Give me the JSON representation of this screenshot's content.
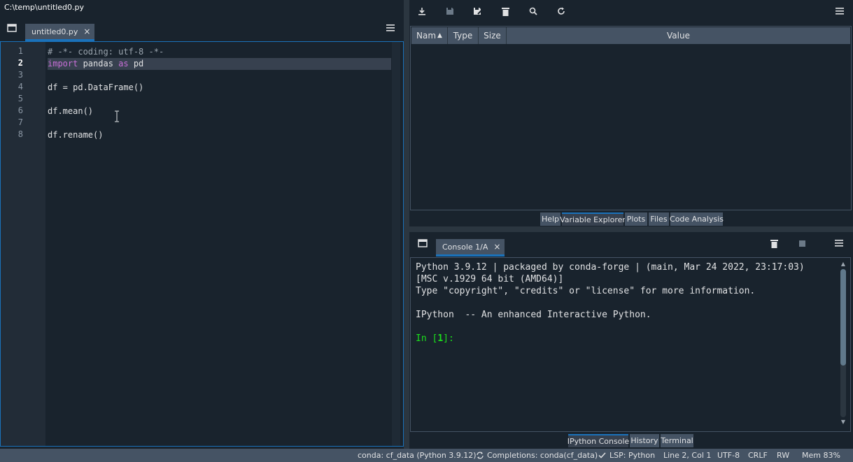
{
  "window": {
    "path": "C:\\temp\\untitled0.py"
  },
  "editor": {
    "tab_label": "untitled0.py",
    "tab_close": "×",
    "line_numbers": [
      "1",
      "2",
      "3",
      "4",
      "5",
      "6",
      "7",
      "8"
    ],
    "current_line": 2,
    "lines": {
      "l1": "# -*- coding: utf-8 -*-",
      "l2_kw1": "import",
      "l2_mid": " pandas ",
      "l2_kw2": "as",
      "l2_end": " pd",
      "l4": "df = pd.DataFrame()",
      "l6": "df.mean()",
      "l8": "df.rename()"
    },
    "icons": {
      "browse": "browse-tabs-icon",
      "options": "hamburger-menu-icon"
    }
  },
  "variable_explorer": {
    "columns": {
      "name": "Nam",
      "type": "Type",
      "size": "Size",
      "value": "Value"
    },
    "sort_indicator": "▲",
    "toolbar_icons": [
      "import-data-icon",
      "save-icon",
      "save-as-icon",
      "delete-all-icon",
      "search-icon",
      "refresh-icon",
      "hamburger-menu-icon"
    ],
    "tabs": {
      "help": "Help",
      "variable_explorer": "Variable Explorer",
      "plots": "Plots",
      "files": "Files",
      "code_analysis": "Code Analysis"
    },
    "active_tab": "Variable Explorer"
  },
  "console": {
    "tab_label": "Console 1/A",
    "tab_close": "×",
    "banner": {
      "l1": "Python 3.9.12 | packaged by conda-forge | (main, Mar 24 2022, 23:17:03)",
      "l2": "[MSC v.1929 64 bit (AMD64)]",
      "l3": "Type \"copyright\", \"credits\" or \"license\" for more information.",
      "l4": "IPython  -- An enhanced Interactive Python."
    },
    "prompt": {
      "before": "In [",
      "num": "1",
      "after": "]:"
    },
    "tabs": {
      "ipython": "IPython Console",
      "history": "History",
      "terminal": "Terminal"
    },
    "active_tab": "IPython Console",
    "toolbar_icons": [
      "browse-tabs-icon",
      "remove-variables-icon",
      "stop-icon",
      "hamburger-menu-icon"
    ]
  },
  "status_bar": {
    "env": "conda: cf_data (Python 3.9.12)",
    "completions": "Completions: conda(cf_data)",
    "lsp": "LSP: Python",
    "position": "Line 2, Col 1",
    "encoding": "UTF-8",
    "eol": "CRLF",
    "permissions": "RW",
    "memory": "Mem 83%"
  },
  "colors": {
    "background": "#19232d",
    "accent": "#1a72bb",
    "keyword": "#c86fd8",
    "prompt": "#1be01b",
    "status_bar": "#455364"
  }
}
